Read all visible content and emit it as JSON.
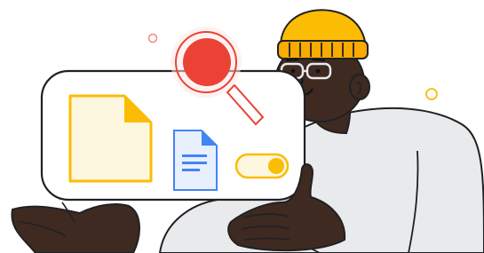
{
  "illustration": {
    "icons": {
      "blank_document": "blank-document-icon",
      "text_document": "text-document-icon",
      "toggle": "toggle-switch-icon",
      "search": "magnifying-glass-icon"
    },
    "toggle_state": "on",
    "colors": {
      "accent_yellow": "#FBBC04",
      "accent_blue": "#4285F4",
      "accent_red": "#EA4335",
      "skin": "#3E2A21",
      "shirt": "#E9EAEB",
      "outline": "#202124"
    }
  }
}
